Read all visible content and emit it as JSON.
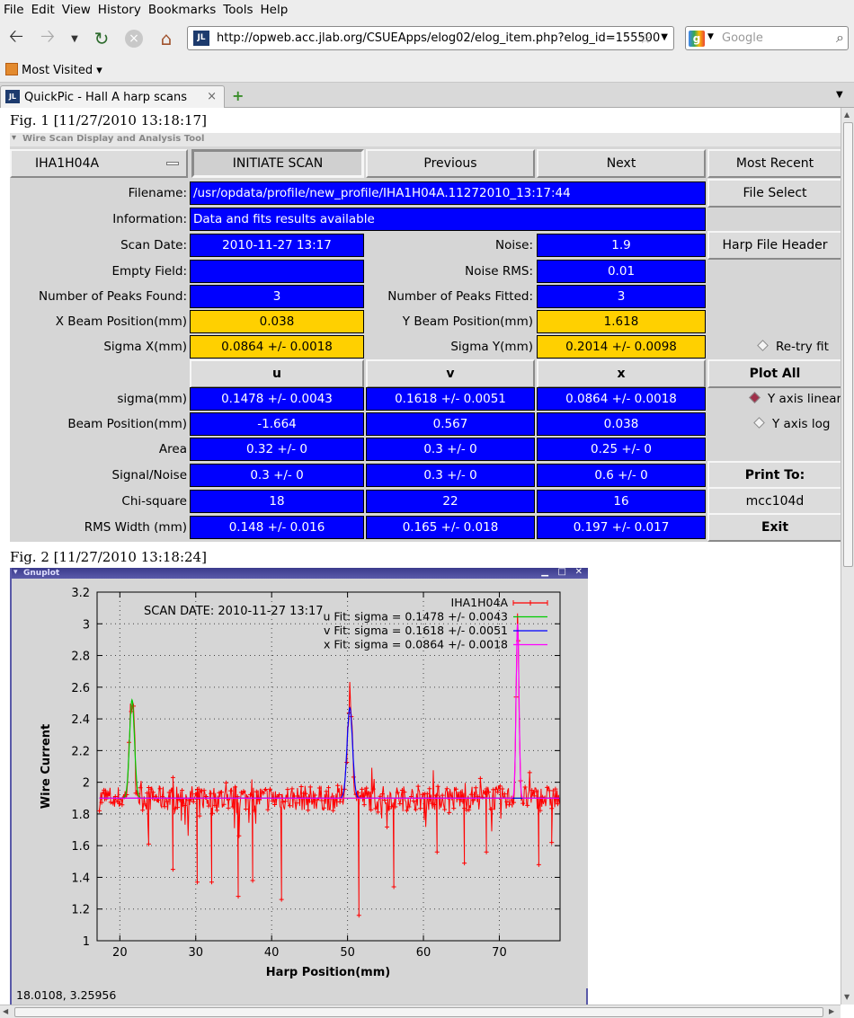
{
  "menu": [
    "File",
    "Edit",
    "View",
    "History",
    "Bookmarks",
    "Tools",
    "Help"
  ],
  "nav": {
    "url": "http://opweb.acc.jlab.org/CSUEApps/elog02/elog_item.php?elog_id=155500",
    "search_placeholder": "Google",
    "favicon_text": "JL"
  },
  "bookmarks": {
    "most_visited": "Most Visited ▾"
  },
  "tab": {
    "title": "QuickPic - Hall A harp scans",
    "close": "×",
    "new": "+"
  },
  "fig1": {
    "label": "Fig. 1 [11/27/2010 13:18:17]",
    "window_title": "Wire Scan Display and Analysis Tool",
    "harp_select": "IHA1H04A",
    "buttons": {
      "initiate": "INITIATE SCAN",
      "previous": "Previous",
      "next": "Next",
      "most_recent": "Most Recent",
      "file_select": "File Select",
      "harp_header": "Harp File Header",
      "plot_all": "Plot All",
      "print_to": "Print To:",
      "printer": "mcc104d",
      "exit": "Exit"
    },
    "labels": {
      "filename": "Filename:",
      "information": "Information:",
      "scan_date": "Scan Date:",
      "empty_field": "Empty Field:",
      "peaks_found": "Number of Peaks Found:",
      "x_beam": "X Beam Position(mm)",
      "sigma_x": "Sigma X(mm)",
      "noise": "Noise:",
      "noise_rms": "Noise RMS:",
      "peaks_fitted": "Number of Peaks Fitted:",
      "y_beam": "Y Beam Position(mm)",
      "sigma_y": "Sigma Y(mm)"
    },
    "values": {
      "filename": "/usr/opdata/profile/new_profile/IHA1H04A.11272010_13:17:44",
      "information": "Data and fits results available",
      "scan_date": "2010-11-27   13:17",
      "empty_field": "",
      "peaks_found": "3",
      "x_beam": "0.038",
      "sigma_x": "0.0864 +/- 0.0018",
      "noise": "1.9",
      "noise_rms": "0.01",
      "peaks_fitted": "3",
      "y_beam": "1.618",
      "sigma_y": "0.2014 +/- 0.0098"
    },
    "radios": {
      "retry": "Re-try fit",
      "linear": "Y axis linear",
      "log": "Y axis log"
    },
    "table": {
      "columns": [
        "u",
        "v",
        "x"
      ],
      "rows": [
        {
          "label": "sigma(mm)",
          "cells": [
            "0.1478 +/- 0.0043",
            "0.1618 +/- 0.0051",
            "0.0864 +/- 0.0018"
          ]
        },
        {
          "label": "Beam Position(mm)",
          "cells": [
            "-1.664",
            "0.567",
            "0.038"
          ]
        },
        {
          "label": "Area",
          "cells": [
            "0.32 +/- 0",
            "0.3 +/- 0",
            "0.25 +/- 0"
          ]
        },
        {
          "label": "Signal/Noise",
          "cells": [
            "0.3 +/- 0",
            "0.3 +/- 0",
            "0.6 +/- 0"
          ]
        },
        {
          "label": "Chi-square",
          "cells": [
            "18",
            "22",
            "16"
          ]
        },
        {
          "label": "RMS Width (mm)",
          "cells": [
            "0.148 +/- 0.016",
            "0.165 +/- 0.018",
            "0.197 +/- 0.017"
          ]
        }
      ]
    }
  },
  "fig2": {
    "label": "Fig. 2 [11/27/2010 13:18:24]",
    "window_title": "Gnuplot",
    "coords": "18.0108,  3.25956"
  },
  "chart_data": {
    "type": "line",
    "xlabel": "Harp Position(mm)",
    "ylabel": "Wire Current",
    "annotation": "SCAN DATE: 2010-11-27   13:17",
    "xlim": [
      17,
      78
    ],
    "ylim": [
      1,
      3.2
    ],
    "xticks": [
      20,
      30,
      40,
      50,
      60,
      70
    ],
    "yticks": [
      1,
      1.2,
      1.4,
      1.6,
      1.8,
      2,
      2.2,
      2.4,
      2.6,
      2.8,
      3,
      3.2
    ],
    "grid": true,
    "legend_position": "top-right",
    "baseline": 1.9,
    "series": [
      {
        "name": "IHA1H04A",
        "color": "#ff0000",
        "kind": "data"
      },
      {
        "name": "u  Fit: sigma = 0.1478 +/- 0.0043",
        "color": "#00cc00",
        "center": 21.6,
        "sigma": 0.1478,
        "amplitude": 0.62
      },
      {
        "name": "v  Fit: sigma = 0.1618 +/- 0.0051",
        "color": "#0000ff",
        "center": 50.3,
        "sigma": 0.1618,
        "amplitude": 0.57
      },
      {
        "name": "x  Fit: sigma = 0.0864 +/- 0.0018",
        "color": "#ff00ff",
        "center": 72.4,
        "sigma": 0.0864,
        "amplitude": 1.1
      }
    ],
    "dips": [
      {
        "x": 23.8,
        "y": 1.61
      },
      {
        "x": 27.0,
        "y": 1.45
      },
      {
        "x": 30.2,
        "y": 1.37
      },
      {
        "x": 32.1,
        "y": 1.37
      },
      {
        "x": 35.6,
        "y": 1.28
      },
      {
        "x": 37.5,
        "y": 1.38
      },
      {
        "x": 41.3,
        "y": 1.26
      },
      {
        "x": 51.5,
        "y": 1.16
      },
      {
        "x": 56.1,
        "y": 1.34
      },
      {
        "x": 61.8,
        "y": 1.56
      },
      {
        "x": 65.4,
        "y": 1.49
      },
      {
        "x": 68.3,
        "y": 1.56
      },
      {
        "x": 75.2,
        "y": 1.48
      },
      {
        "x": 76.9,
        "y": 1.62
      }
    ]
  }
}
